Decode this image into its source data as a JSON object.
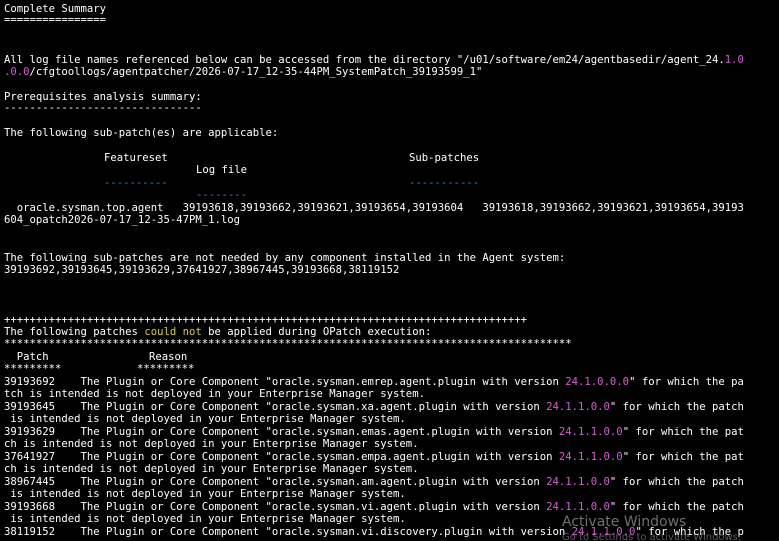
{
  "colors": {
    "background": "#000000",
    "text": "#ffffff",
    "version_highlight": "#d65ad6",
    "could_not_highlight": "#d7d400",
    "dash_underline": "#3a7bd5"
  },
  "terminal": {
    "summary_title": "Complete Summary",
    "summary_rule": "================",
    "dir_line_1": "All log file names referenced below can be accessed from the directory \"/u01/software/em24/agentbasedir/agent_24.",
    "dir_version_part": "1.0",
    "dir_line_2a": ".0.0",
    "dir_line_2b": "/cfgtoollogs/agentpatcher/2026-07-17_12-35-44PM_SystemPatch_39193599_1\"",
    "prereq_title": "Prerequisites analysis summary:",
    "prereq_rule": "-------------------------------",
    "applicable_line": "The following sub-patch(es) are applicable:",
    "col_featureset": "Featureset",
    "col_subpatches": "Sub-patches",
    "col_logfile": "Log file",
    "dash_featureset": "----------",
    "dash_subpatches": "-----------",
    "dash_logfile": "--------",
    "row_line_1": "  oracle.sysman.top.agent   39193618,39193662,39193621,39193654,39193604   39193618,39193662,39193621,39193654,39193",
    "row_line_2": "604_opatch2026-07-17_12-35-47PM_1.log",
    "not_needed_line": "The following sub-patches are not needed by any component installed in the Agent system:",
    "not_needed_list": "39193692,39193645,39193629,37641927,38967445,39193668,38119152",
    "plus_rule": "++++++++++++++++++++++++++++++++++++++++++++++++++++++++++++++++++++++++++++++++++",
    "failed_prefix": "The following patches ",
    "failed_could_not": "could not",
    "failed_suffix": " be applied during OPatch execution:",
    "star_rule": "*****************************************************************************************",
    "col_patch": "  Patch",
    "col_reason": "Reason",
    "star_patch": "*********",
    "star_reason": "*********",
    "patches": [
      {
        "id": "39193692",
        "pre": "    The Plugin or Core Component \"oracle.sysman.emrep.agent.plugin with version ",
        "version": "24.1.0.0.0",
        "post": "\" for which the pa",
        "cont": "tch is intended is not deployed in your Enterprise Manager system."
      },
      {
        "id": "39193645",
        "pre": "    The Plugin or Core Component \"oracle.sysman.xa.agent.plugin with version ",
        "version": "24.1.1.0.0",
        "post": "\" for which the patch",
        "cont": " is intended is not deployed in your Enterprise Manager system."
      },
      {
        "id": "39193629",
        "pre": "    The Plugin or Core Component \"oracle.sysman.emas.agent.plugin with version ",
        "version": "24.1.1.0.0",
        "post": "\" for which the pat",
        "cont": "ch is intended is not deployed in your Enterprise Manager system."
      },
      {
        "id": "37641927",
        "pre": "    The Plugin or Core Component \"oracle.sysman.empa.agent.plugin with version ",
        "version": "24.1.1.0.0",
        "post": "\" for which the pat",
        "cont": "ch is intended is not deployed in your Enterprise Manager system."
      },
      {
        "id": "38967445",
        "pre": "    The Plugin or Core Component \"oracle.sysman.am.agent.plugin with version ",
        "version": "24.1.1.0.0",
        "post": "\" for which the patch",
        "cont": " is intended is not deployed in your Enterprise Manager system."
      },
      {
        "id": "39193668",
        "pre": "    The Plugin or Core Component \"oracle.sysman.vi.agent.plugin with version ",
        "version": "24.1.1.0.0",
        "post": "\" for which the patch",
        "cont": " is intended is not deployed in your Enterprise Manager system."
      },
      {
        "id": "38119152",
        "pre": "    The Plugin or Core Component \"oracle.sysman.vi.discovery.plugin with version ",
        "version": "24.1.1.0.0",
        "post": "\" for which the p",
        "cont": ""
      }
    ]
  },
  "watermark": {
    "title": "Activate Windows",
    "subtitle": "Go to Settings to activate Windows."
  }
}
